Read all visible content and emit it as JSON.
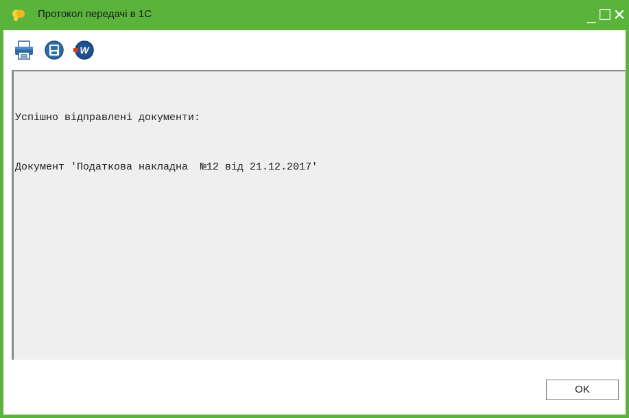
{
  "window": {
    "title": "Протокол передачі в 1С",
    "accent_color": "#5ab43c",
    "controls": {
      "minimize": "_",
      "maximize": "☐",
      "close": "✕"
    }
  },
  "toolbar": {
    "items": [
      {
        "icon": "printer-icon"
      },
      {
        "icon": "save-icon"
      },
      {
        "icon": "word-export-icon"
      }
    ]
  },
  "log": {
    "lines": [
      "Успішно відправлені документи:",
      "Документ 'Податкова накладна  №12 від 21.12.2017'"
    ]
  },
  "footer": {
    "ok_label": "OK"
  }
}
